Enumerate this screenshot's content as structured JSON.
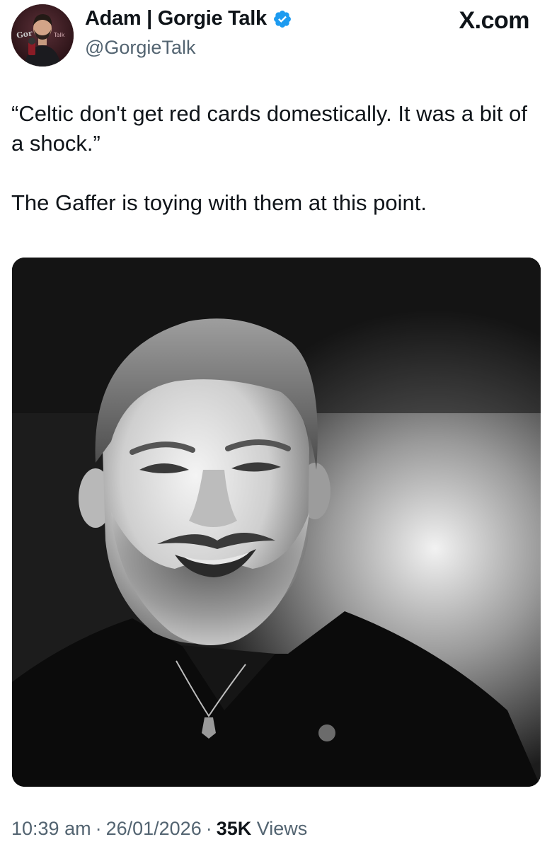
{
  "author": {
    "display_name": "Adam | Gorgie Talk",
    "handle": "@GorgieTalk",
    "verified": true,
    "avatar_text": "Gorgie Talk"
  },
  "source": {
    "label": "X.com"
  },
  "tweet": {
    "paragraphs": [
      "“Celtic don't get red cards domestically. It was a bit of a shock.”",
      "The Gaffer is toying with them at this point."
    ]
  },
  "meta": {
    "time": "10:39 am",
    "date": "26/01/2026",
    "views_count": "35K",
    "views_label": "Views",
    "separator": "·"
  },
  "colors": {
    "text": "#0f1419",
    "muted": "#536471",
    "verified": "#1d9bf0"
  }
}
